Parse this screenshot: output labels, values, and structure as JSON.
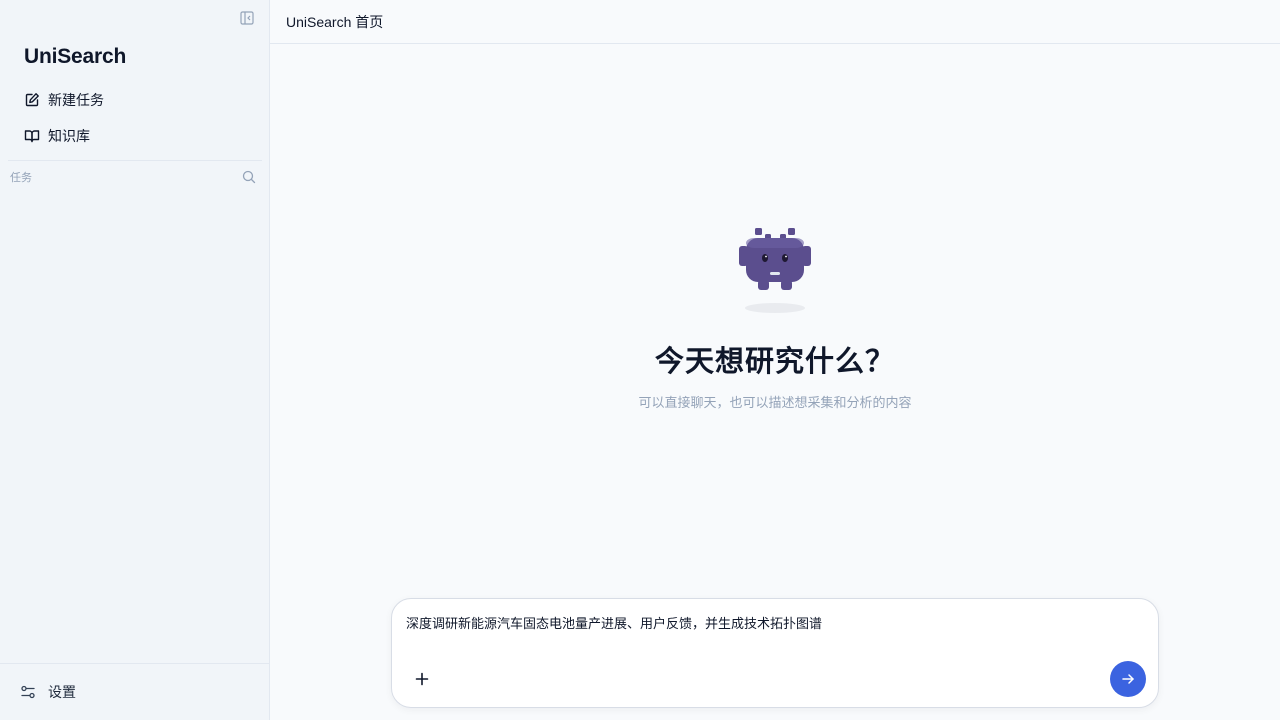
{
  "app": {
    "brand": "UniSearch"
  },
  "sidebar": {
    "collapse_icon": "sidebar-collapse-icon",
    "nav": [
      {
        "label": "新建任务",
        "icon": "edit-icon"
      },
      {
        "label": "知识库",
        "icon": "book-icon"
      }
    ],
    "tasks_label": "任务",
    "footer": {
      "label": "设置",
      "icon": "settings-sliders-icon"
    }
  },
  "header": {
    "title": "UniSearch 首页"
  },
  "hero": {
    "title": "今天想研究什么？",
    "subtitle": "可以直接聊天，也可以描述想采集和分析的内容"
  },
  "composer": {
    "value": "深度调研新能源汽车固态电池量产进展、用户反馈，并生成技术拓扑图谱",
    "attach_icon": "plus-icon",
    "send_icon": "arrow-right-icon"
  },
  "colors": {
    "accent": "#3b63e0",
    "mascot": "#5b4e8e",
    "sidebar_bg": "#f1f5f9",
    "main_bg": "#f8fafc"
  }
}
